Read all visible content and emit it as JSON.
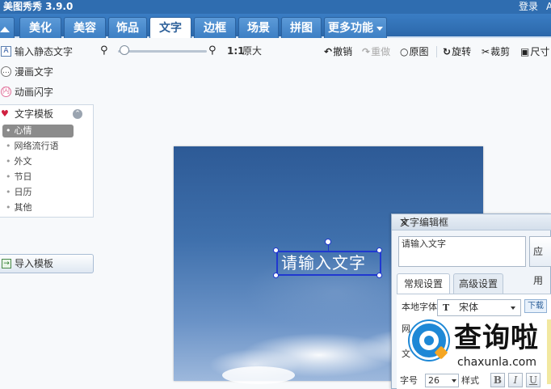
{
  "window": {
    "title": "美图秀秀 3.9.0",
    "login": "登录",
    "extra": "A"
  },
  "tabs": [
    {
      "label": "",
      "icon": "home-icon"
    },
    {
      "label": "美化"
    },
    {
      "label": "美容"
    },
    {
      "label": "饰品"
    },
    {
      "label": "文字",
      "active": true
    },
    {
      "label": "边框"
    },
    {
      "label": "场景"
    },
    {
      "label": "拼图"
    },
    {
      "label": "更多功能"
    }
  ],
  "sidebar": {
    "items": [
      {
        "label": "输入静态文字",
        "icon": "text-input-icon",
        "glyph": "A"
      },
      {
        "label": "漫画文字",
        "icon": "speech-bubble-icon",
        "glyph": "…"
      },
      {
        "label": "动画闪字",
        "icon": "flash-text-icon",
        "glyph": "闪"
      }
    ],
    "template": {
      "title": "文字模板",
      "categories": [
        "心情",
        "网络流行语",
        "外文",
        "节日",
        "日历",
        "其他"
      ],
      "selected": "心情"
    },
    "import_label": "导入模板"
  },
  "toolbar": {
    "zoom_ratio": "1:1",
    "original_size": "原大",
    "zoom_level": 0.05,
    "undo": "撤销",
    "redo": "重做",
    "original": "原图",
    "rotate": "旋转",
    "crop": "裁剪",
    "size": "尺寸"
  },
  "canvas": {
    "text": "请输入文字"
  },
  "text_dialog": {
    "title": "文字编辑框",
    "close": "✕",
    "input_value": "请输入文字",
    "apply": "应用",
    "tabs": [
      "常规设置",
      "高级设置"
    ],
    "font_label": "本地字体",
    "font_value": "宋体",
    "download": "下载",
    "label_cut1": "网",
    "label_cut2": "文",
    "size_label": "字号",
    "size_value": "26",
    "style_label": "样式",
    "bold": "B",
    "italic": "I",
    "underline": "U"
  },
  "watermark": {
    "name": "查询啦",
    "url": "chaxunla.com"
  }
}
